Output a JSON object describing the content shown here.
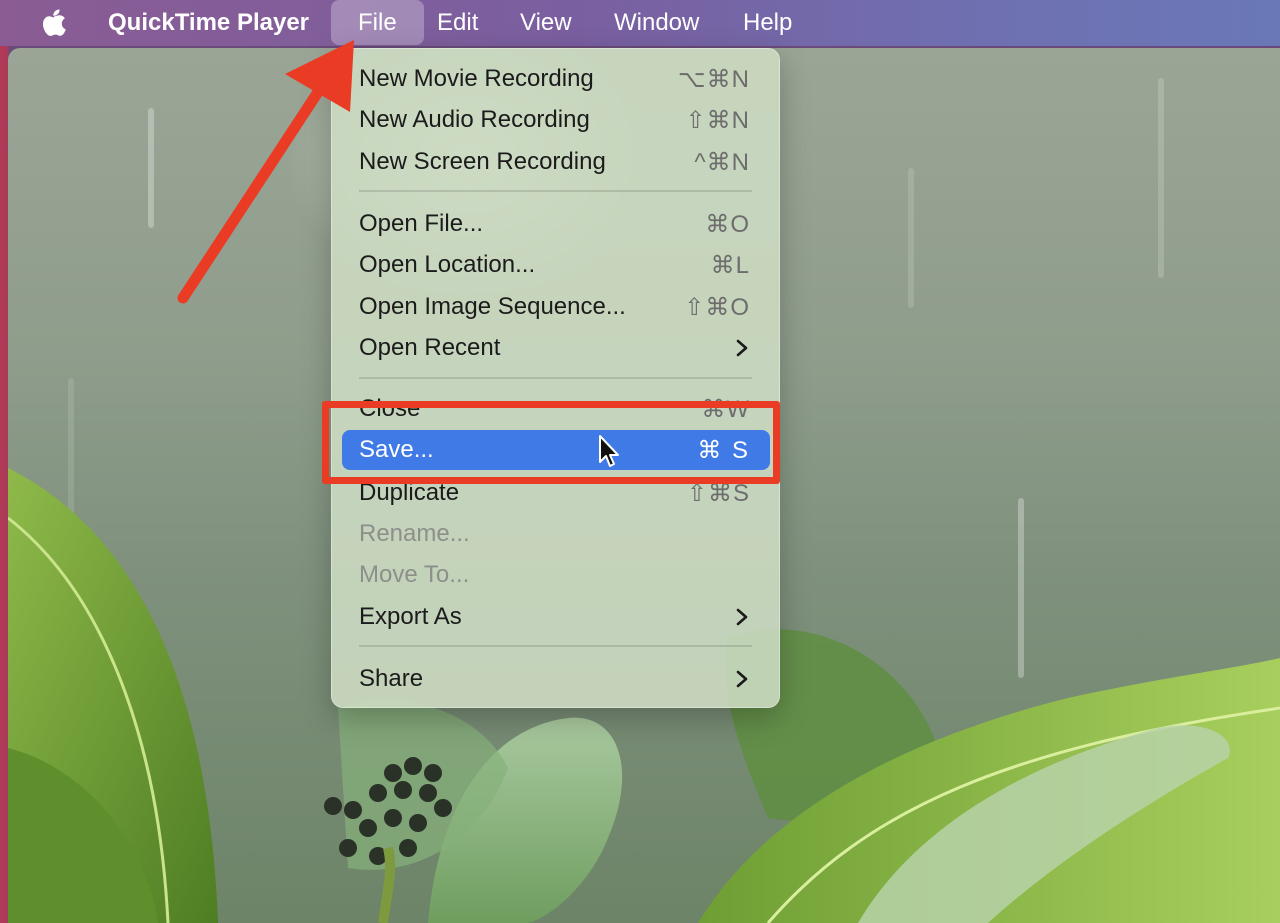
{
  "menubar": {
    "apple_icon": "apple-logo-icon",
    "app_name": "QuickTime Player",
    "menus": [
      "File",
      "Edit",
      "View",
      "Window",
      "Help"
    ]
  },
  "file_menu": {
    "items": [
      {
        "label": "New Movie Recording",
        "shortcut": "⌥⌘N"
      },
      {
        "label": "New Audio Recording",
        "shortcut": "⇧⌘N"
      },
      {
        "label": "New Screen Recording",
        "shortcut": "^⌘N"
      },
      {
        "label": "Open File...",
        "shortcut": "⌘O"
      },
      {
        "label": "Open Location...",
        "shortcut": "⌘L"
      },
      {
        "label": "Open Image Sequence...",
        "shortcut": "⇧⌘O"
      },
      {
        "label": "Open Recent",
        "submenu": true
      },
      {
        "label": "Close",
        "shortcut": "⌘W"
      },
      {
        "label": "Save...",
        "shortcut": "⌘ S",
        "highlighted": true
      },
      {
        "label": "Duplicate",
        "shortcut": "⇧⌘S"
      },
      {
        "label": "Rename...",
        "disabled": true
      },
      {
        "label": "Move To...",
        "disabled": true
      },
      {
        "label": "Export As",
        "submenu": true
      },
      {
        "label": "Share",
        "submenu": true
      }
    ]
  },
  "colors": {
    "highlight": "#3f7ae6",
    "annotation": "#ea3b25"
  }
}
